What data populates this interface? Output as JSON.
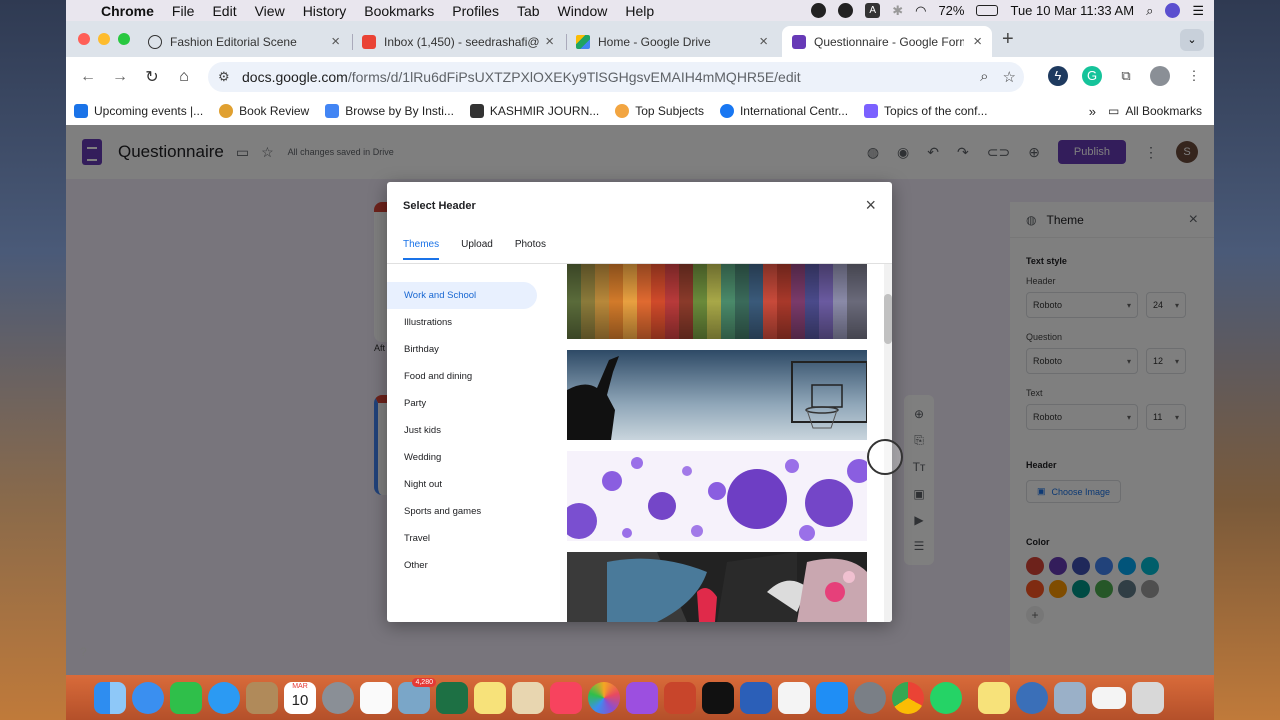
{
  "menubar": {
    "app": "Chrome",
    "items": [
      "File",
      "Edit",
      "View",
      "History",
      "Bookmarks",
      "Profiles",
      "Tab",
      "Window",
      "Help"
    ],
    "battery": "72%",
    "datetime": "Tue 10 Mar  11:33 AM",
    "input_source": "A"
  },
  "tabs": [
    {
      "title": "Fashion Editorial Scene",
      "favicon": "chatgpt-icon",
      "color": "#333333"
    },
    {
      "title": "Inbox (1,450) - seedrashafi@",
      "favicon": "gmail-icon",
      "color": "#ea4335"
    },
    {
      "title": "Home - Google Drive",
      "favicon": "google-drive-icon",
      "color": "#1fa463"
    },
    {
      "title": "Questionnaire - Google Form",
      "favicon": "google-forms-icon",
      "color": "#673ab7"
    }
  ],
  "omnibox": {
    "domain": "docs.google.com",
    "path": "/forms/d/1lRu6dFiPsUXTZPXlOXEKy9TlSGHgsvEMAIH4mMQHR5E/edit"
  },
  "bookmarks": [
    {
      "label": "Upcoming events |...",
      "color": "#1a73e8"
    },
    {
      "label": "Book Review",
      "color": "#e0a030"
    },
    {
      "label": "Browse by By Insti...",
      "color": "#4285f4"
    },
    {
      "label": "KASHMIR JOURN...",
      "color": "#333333"
    },
    {
      "label": "Top Subjects",
      "color": "#f2a541"
    },
    {
      "label": "International Centr...",
      "color": "#1877f2"
    },
    {
      "label": "Topics of the conf...",
      "color": "#7b61ff"
    }
  ],
  "bookmarks_more": "»",
  "bookmarks_all": "All Bookmarks",
  "form": {
    "title": "Questionnaire",
    "saved_status": "All changes saved in Drive",
    "publish_label": "Publish",
    "avatar_initial": "S",
    "partial_text": "Aft"
  },
  "theme_panel": {
    "title": "Theme",
    "text_style_label": "Text style",
    "header_label": "Header",
    "header_font": "Roboto",
    "header_size": "24",
    "question_label": "Question",
    "question_font": "Roboto",
    "question_size": "12",
    "text_label": "Text",
    "text_font": "Roboto",
    "text_size": "11",
    "header_section_label": "Header",
    "choose_image_label": "Choose Image",
    "color_label": "Color",
    "colors": [
      "#db4437",
      "#673ab7",
      "#3f51b5",
      "#4285f4",
      "#03a9f4",
      "#00bcd4",
      "#ff5722",
      "#ff9800",
      "#009688",
      "#4caf50",
      "#607d8b",
      "#9e9e9e"
    ]
  },
  "dialog": {
    "title": "Select Header",
    "tabs": [
      "Themes",
      "Upload",
      "Photos"
    ],
    "active_tab": "Themes",
    "categories": [
      "Work and School",
      "Illustrations",
      "Birthday",
      "Food and dining",
      "Party",
      "Just kids",
      "Wedding",
      "Night out",
      "Sports and games",
      "Travel",
      "Other"
    ],
    "active_category": "Work and School",
    "images": [
      {
        "name": "colored-yarn-image"
      },
      {
        "name": "basketball-hoop-image"
      },
      {
        "name": "purple-spheres-image"
      },
      {
        "name": "painted-hands-image"
      }
    ]
  },
  "dock": {
    "calendar_month": "MAR",
    "calendar_day": "10",
    "badge_count": "4,280"
  }
}
